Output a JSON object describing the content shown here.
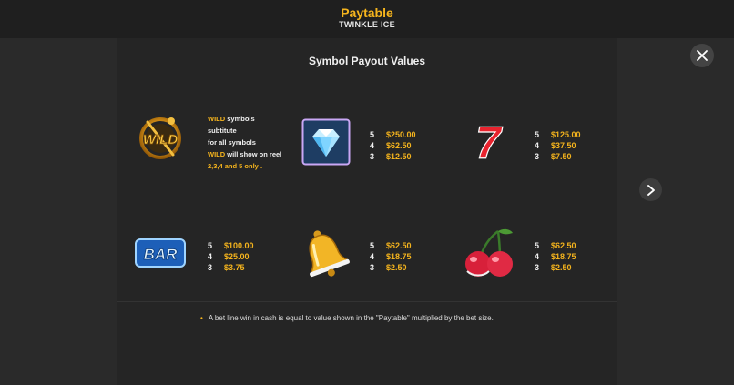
{
  "header": {
    "title": "Paytable",
    "subtitle": "TWINKLE ICE"
  },
  "section_title": "Symbol Payout Values",
  "wild": {
    "logo_text": "WILD",
    "line1_hl": "WILD",
    "line1_rest": " symbols",
    "line2": "subtitute",
    "line3": "for all symbols",
    "line4_hl": "WILD",
    "line4_rest": " will show on reel",
    "line5": "2,3,4 and 5 only ."
  },
  "symbols": [
    {
      "name": "diamond",
      "pays": [
        {
          "count": "5",
          "amount": "$250.00"
        },
        {
          "count": "4",
          "amount": "$62.50"
        },
        {
          "count": "3",
          "amount": "$12.50"
        }
      ]
    },
    {
      "name": "seven",
      "glyph": "7",
      "pays": [
        {
          "count": "5",
          "amount": "$125.00"
        },
        {
          "count": "4",
          "amount": "$37.50"
        },
        {
          "count": "3",
          "amount": "$7.50"
        }
      ]
    },
    {
      "name": "bar",
      "glyph": "BAR",
      "pays": [
        {
          "count": "5",
          "amount": "$100.00"
        },
        {
          "count": "4",
          "amount": "$25.00"
        },
        {
          "count": "3",
          "amount": "$3.75"
        }
      ]
    },
    {
      "name": "bell",
      "pays": [
        {
          "count": "5",
          "amount": "$62.50"
        },
        {
          "count": "4",
          "amount": "$18.75"
        },
        {
          "count": "3",
          "amount": "$2.50"
        }
      ]
    },
    {
      "name": "cherry",
      "pays": [
        {
          "count": "5",
          "amount": "$62.50"
        },
        {
          "count": "4",
          "amount": "$18.75"
        },
        {
          "count": "3",
          "amount": "$2.50"
        }
      ]
    }
  ],
  "note": "A bet line win in cash is equal to value shown in the \"Paytable\" multiplied by the bet size.",
  "icons": {
    "close": "close-icon",
    "next": "chevron-right-icon"
  },
  "colors": {
    "accent": "#f5b41d",
    "background": "#2a2a2a",
    "panel": "#252525"
  }
}
